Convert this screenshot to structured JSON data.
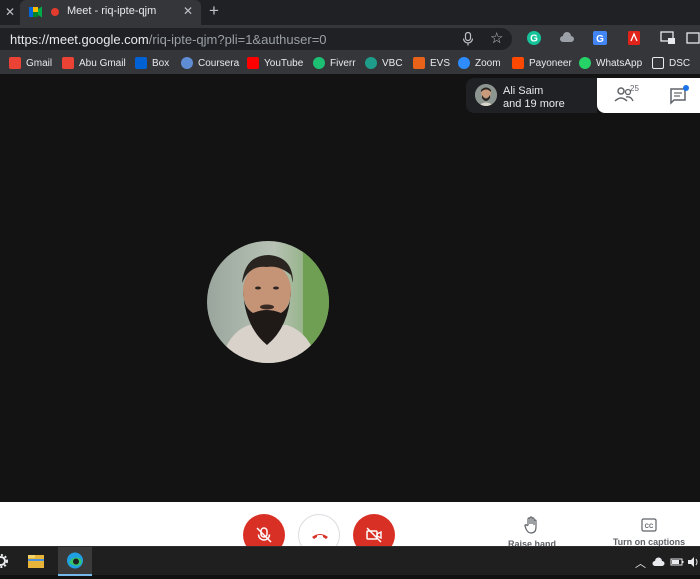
{
  "browser": {
    "tab_title": "Meet - riq-ipte-qjm",
    "url_host": "https://meet.google.com",
    "url_path": "/riq-ipte-qjm?pli=1&authuser=0"
  },
  "bookmarks": [
    {
      "label": "Gmail",
      "color": "#ea4335"
    },
    {
      "label": "Abu Gmail",
      "color": "#ea4335"
    },
    {
      "label": "Box",
      "color": "#0061d5"
    },
    {
      "label": "Coursera",
      "color": "#5f8dd3"
    },
    {
      "label": "YouTube",
      "color": "#ff0000"
    },
    {
      "label": "Fiverr",
      "color": "#1dbf73"
    },
    {
      "label": "VBC",
      "color": "#1e9e8a"
    },
    {
      "label": "EVS",
      "color": "#e8621a"
    },
    {
      "label": "Zoom",
      "color": "#2d8cff"
    },
    {
      "label": "Payoneer",
      "color": "#ff4800"
    },
    {
      "label": "WhatsApp",
      "color": "#25d366"
    },
    {
      "label": "DSC",
      "color": "#e8eaed"
    }
  ],
  "meeting": {
    "participant_name": "Ali Saim",
    "participant_more": "and 19 more",
    "people_count": "25"
  },
  "controls": {
    "raise_hand": "Raise hand",
    "captions": "Turn on captions"
  },
  "colors": {
    "danger": "#d93025",
    "accent": "#1a73e8"
  }
}
